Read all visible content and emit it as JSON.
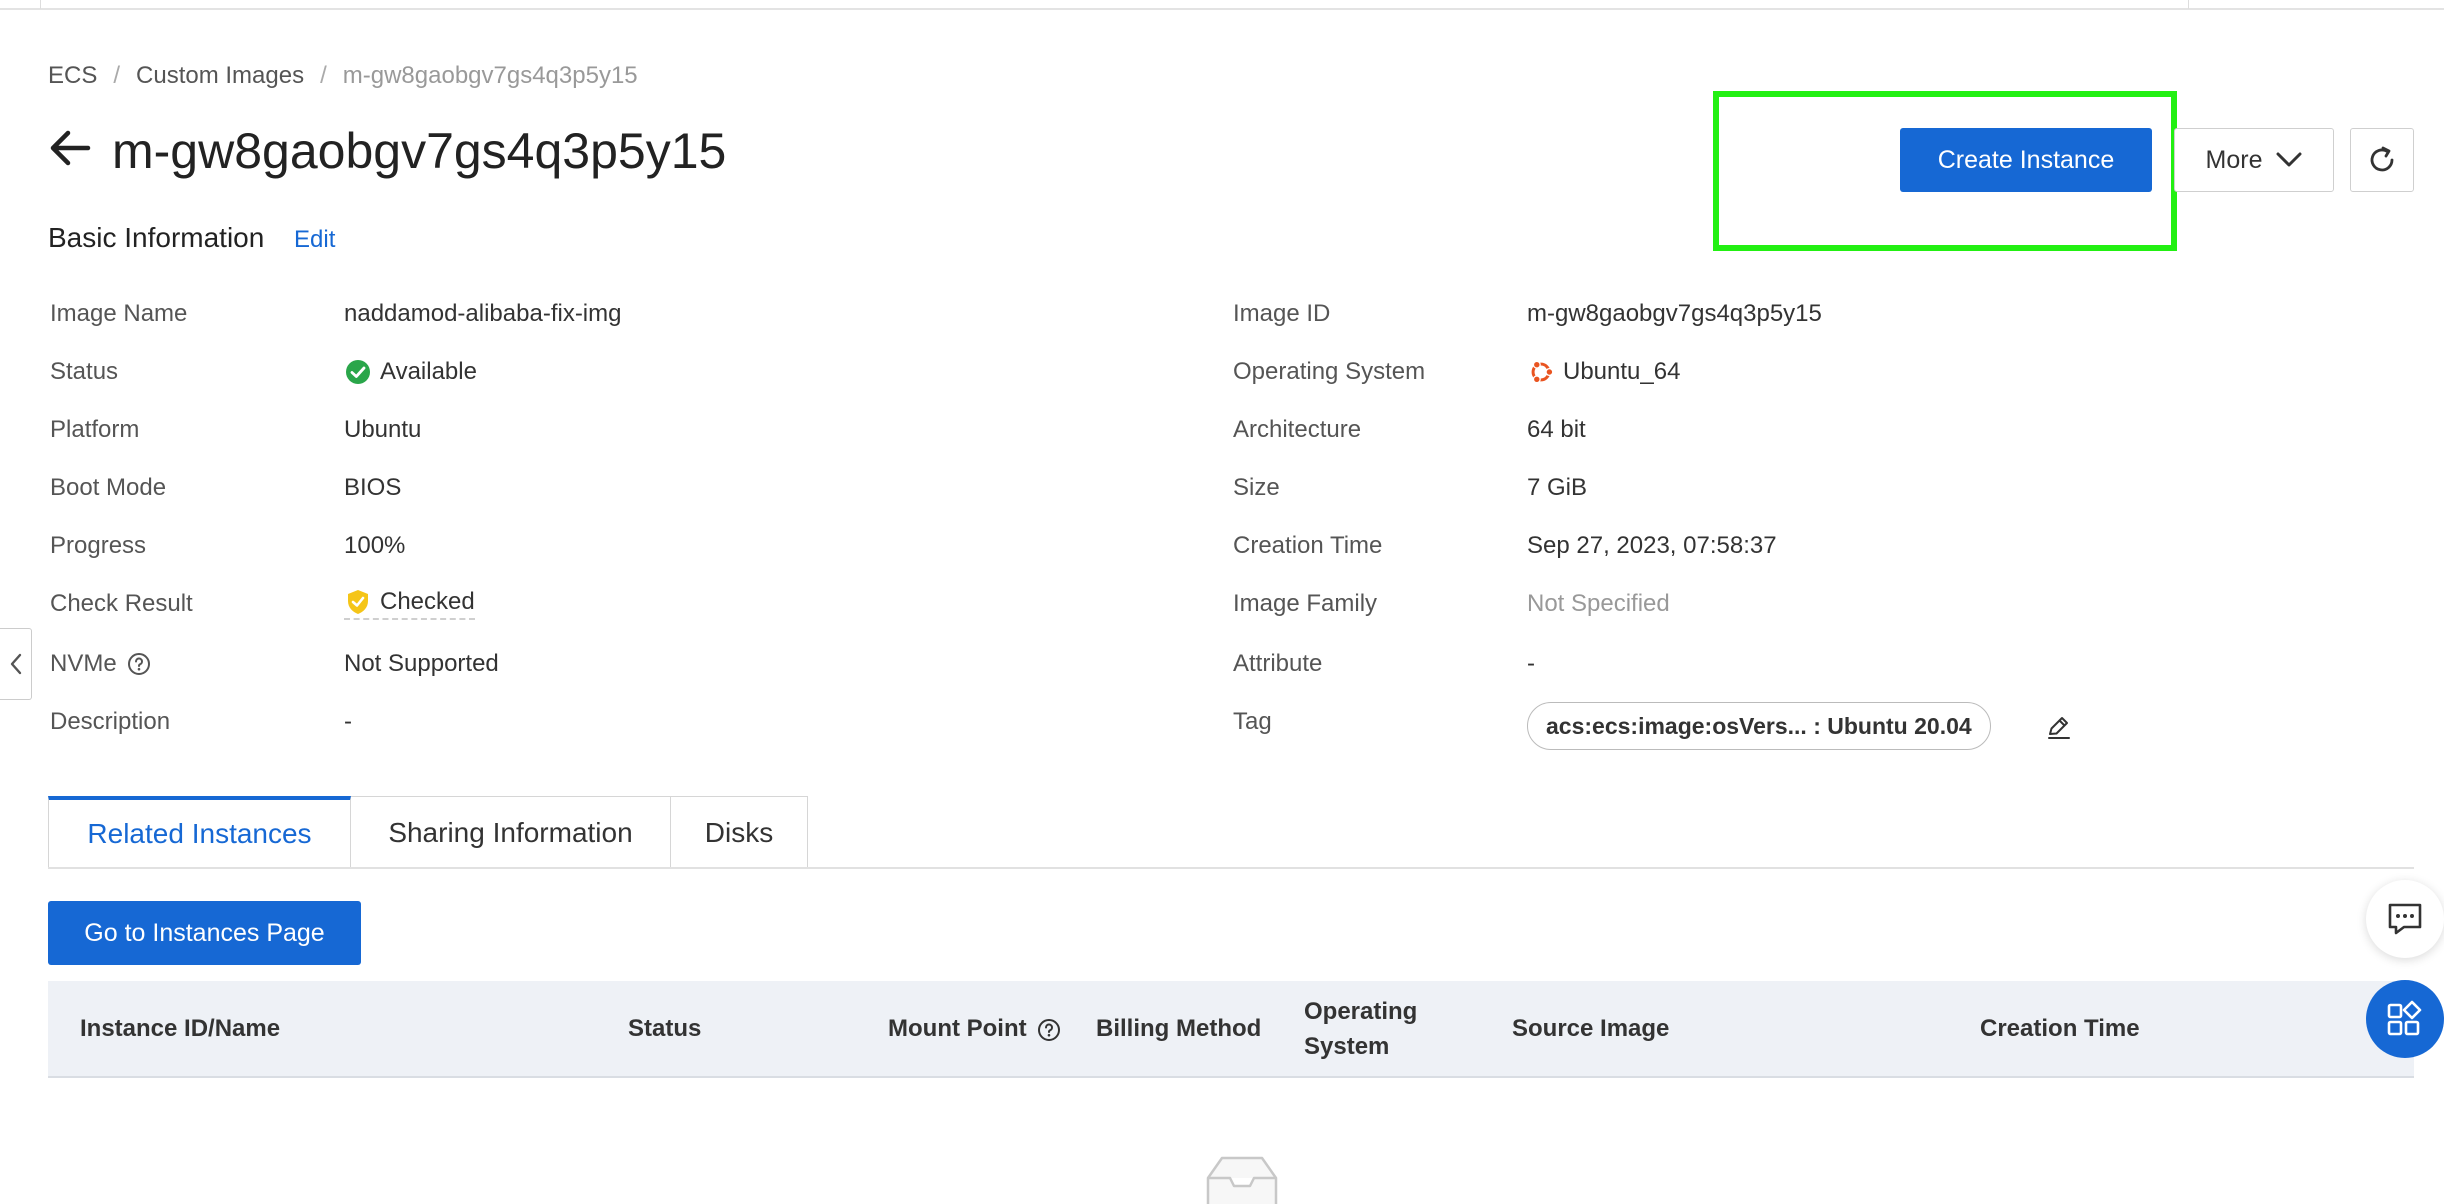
{
  "breadcrumb": {
    "items": [
      "ECS",
      "Custom Images"
    ],
    "current": "m-gw8gaobgv7gs4q3p5y15",
    "separator": "/"
  },
  "header": {
    "title": "m-gw8gaobgv7gs4q3p5y15",
    "create_instance_label": "Create Instance",
    "more_label": "More"
  },
  "basic_info": {
    "title": "Basic Information",
    "edit_label": "Edit",
    "left": [
      {
        "label": "Image Name",
        "value": "naddamod-alibaba-fix-img"
      },
      {
        "label": "Status",
        "value": "Available"
      },
      {
        "label": "Platform",
        "value": "Ubuntu"
      },
      {
        "label": "Boot Mode",
        "value": "BIOS"
      },
      {
        "label": "Progress",
        "value": "100%"
      },
      {
        "label": "Check Result",
        "value": "Checked"
      },
      {
        "label": "NVMe",
        "value": "Not Supported"
      },
      {
        "label": "Description",
        "value": "-"
      }
    ],
    "right": [
      {
        "label": "Image ID",
        "value": "m-gw8gaobgv7gs4q3p5y15"
      },
      {
        "label": "Operating System",
        "value": "Ubuntu_64"
      },
      {
        "label": "Architecture",
        "value": "64 bit"
      },
      {
        "label": "Size",
        "value": "7 GiB"
      },
      {
        "label": "Creation Time",
        "value": "Sep 27, 2023, 07:58:37"
      },
      {
        "label": "Image Family",
        "value": "Not Specified"
      },
      {
        "label": "Attribute",
        "value": "-"
      },
      {
        "label": "Tag",
        "value": "acs:ecs:image:osVers... : Ubuntu 20.04"
      }
    ]
  },
  "tabs": [
    {
      "label": "Related Instances",
      "active": true
    },
    {
      "label": "Sharing Information",
      "active": false
    },
    {
      "label": "Disks",
      "active": false
    }
  ],
  "goto_instances_label": "Go to Instances Page",
  "table": {
    "columns": [
      "Instance ID/Name",
      "Status",
      "Mount Point",
      "Billing Method",
      "Operating System",
      "Source Image",
      "Creation Time"
    ]
  },
  "colors": {
    "primary": "#1668d4",
    "highlight": "#22f012",
    "success": "#2aa64a",
    "ubuntu": "#e95420",
    "check": "#f5c518"
  }
}
